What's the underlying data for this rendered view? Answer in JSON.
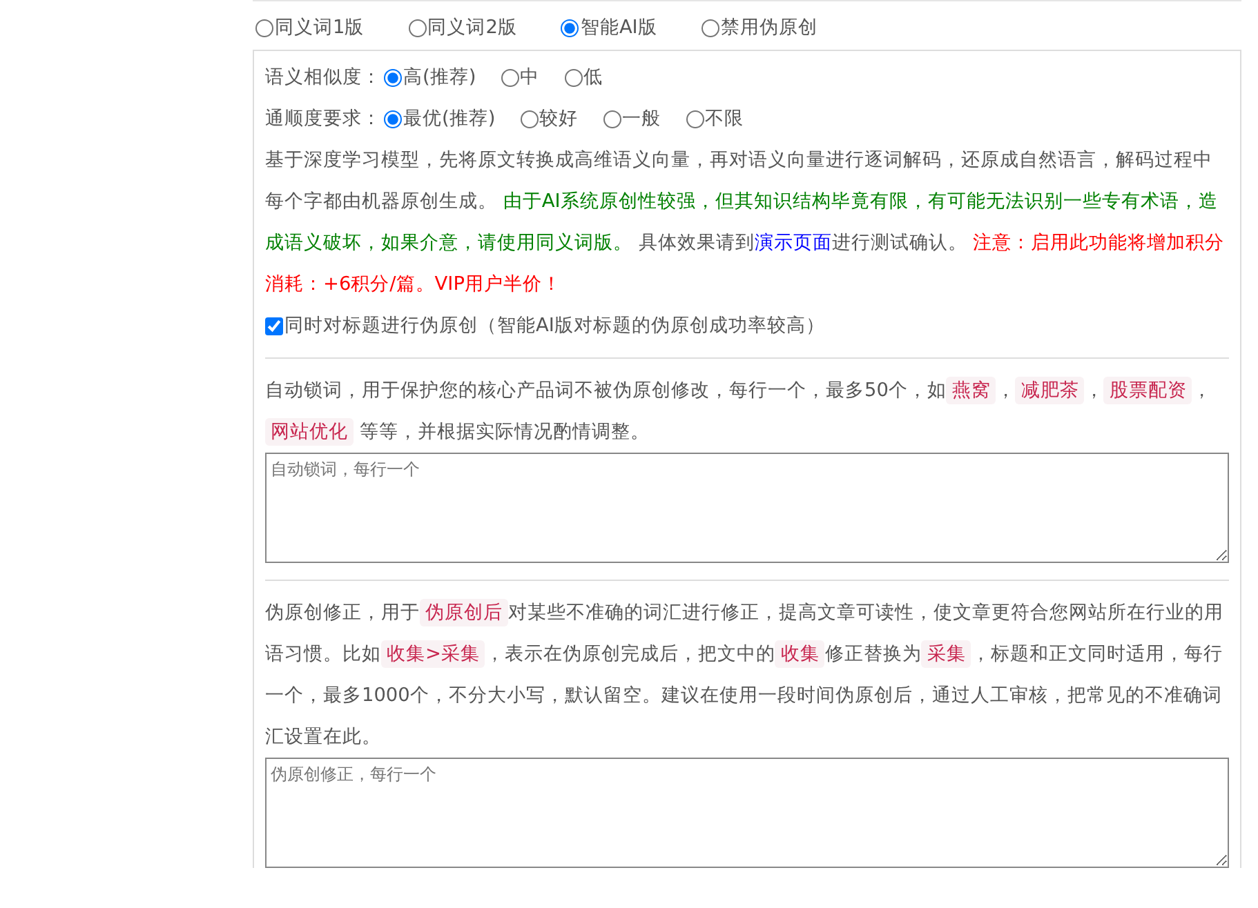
{
  "modes": [
    {
      "label": "同义词1版",
      "selected": false
    },
    {
      "label": "同义词2版",
      "selected": false
    },
    {
      "label": "智能AI版",
      "selected": true
    },
    {
      "label": "禁用伪原创",
      "selected": false
    }
  ],
  "similarity": {
    "label": "语义相似度：",
    "options": [
      {
        "label": "高(推荐)",
        "selected": true
      },
      {
        "label": "中",
        "selected": false
      },
      {
        "label": "低",
        "selected": false
      }
    ]
  },
  "fluency": {
    "label": "通顺度要求：",
    "options": [
      {
        "label": "最优(推荐)",
        "selected": true
      },
      {
        "label": "较好",
        "selected": false
      },
      {
        "label": "一般",
        "selected": false
      },
      {
        "label": "不限",
        "selected": false
      }
    ]
  },
  "description": [
    {
      "kind": "text",
      "text": "基于深度学习模型，先将原文转换成高维语义向量，再对语义向量进行逐词解码，还原成自然语言，解码过程中每个字都由机器原创生成。 "
    },
    {
      "kind": "green",
      "text": "由于AI系统原创性较强，但其知识结构毕竟有限，有可能无法识别一些专有术语，造成语义破坏，如果介意，请使用同义词版。"
    },
    {
      "kind": "text",
      "text": " 具体效果请到"
    },
    {
      "kind": "link",
      "text": "演示页面"
    },
    {
      "kind": "text",
      "text": "进行测试确认。 "
    },
    {
      "kind": "red",
      "text": "注意：启用此功能将增加积分消耗：+6积分/篇。VIP用户半价！"
    }
  ],
  "title_option": {
    "label": "同时对标题进行伪原创（智能AI版对标题的伪原创成功率较高）",
    "checked": true
  },
  "lock_words": {
    "description": [
      {
        "kind": "text",
        "text": "自动锁词，用于保护您的核心产品词不被伪原创修改，每行一个，最多50个，如"
      },
      {
        "kind": "tag",
        "text": "燕窝"
      },
      {
        "kind": "text",
        "text": "，"
      },
      {
        "kind": "tag",
        "text": "减肥茶"
      },
      {
        "kind": "text",
        "text": "，"
      },
      {
        "kind": "tag",
        "text": "股票配资"
      },
      {
        "kind": "text",
        "text": "，"
      },
      {
        "kind": "tag",
        "text": "网站优化"
      },
      {
        "kind": "text",
        "text": " 等等，并根据实际情况酌情调整。"
      }
    ],
    "placeholder": "自动锁词，每行一个"
  },
  "corrections": {
    "description": [
      {
        "kind": "text",
        "text": "伪原创修正，用于"
      },
      {
        "kind": "tag",
        "text": "伪原创后"
      },
      {
        "kind": "text",
        "text": "对某些不准确的词汇进行修正，提高文章可读性，使文章更符合您网站所在行业的用语习惯。比如"
      },
      {
        "kind": "tag",
        "text": "收集>采集"
      },
      {
        "kind": "text",
        "text": "，表示在伪原创完成后，把文中的"
      },
      {
        "kind": "tag",
        "text": "收集"
      },
      {
        "kind": "text",
        "text": "修正替换为"
      },
      {
        "kind": "tag",
        "text": "采集"
      },
      {
        "kind": "text",
        "text": "，标题和正文同时适用，每行一个，最多1000个，不分大小写，默认留空。建议在使用一段时间伪原创后，通过人工审核，把常见的不准确词汇设置在此。"
      }
    ],
    "placeholder": "伪原创修正，每行一个"
  }
}
